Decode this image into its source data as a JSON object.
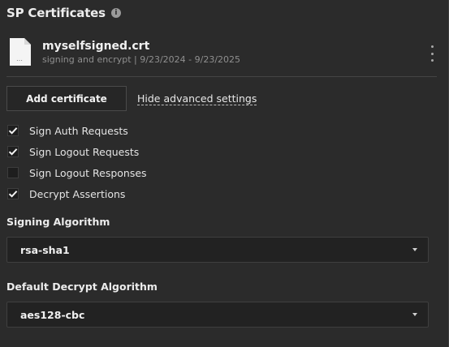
{
  "header": {
    "title": "SP Certificates",
    "info_icon": "i"
  },
  "certificate": {
    "name": "myselfsigned.crt",
    "meta": "signing and encrypt | 9/23/2024 - 9/23/2025",
    "file_icon": "…"
  },
  "actions": {
    "add_certificate": "Add certificate",
    "toggle_advanced": "Hide advanced settings"
  },
  "options": [
    {
      "label": "Sign Auth Requests",
      "checked": true
    },
    {
      "label": "Sign Logout Requests",
      "checked": true
    },
    {
      "label": "Sign Logout Responses",
      "checked": false
    },
    {
      "label": "Decrypt Assertions",
      "checked": true
    }
  ],
  "signing": {
    "label": "Signing Algorithm",
    "value": "rsa-sha1"
  },
  "decrypt": {
    "label": "Default Decrypt Algorithm",
    "value": "aes128-cbc"
  }
}
